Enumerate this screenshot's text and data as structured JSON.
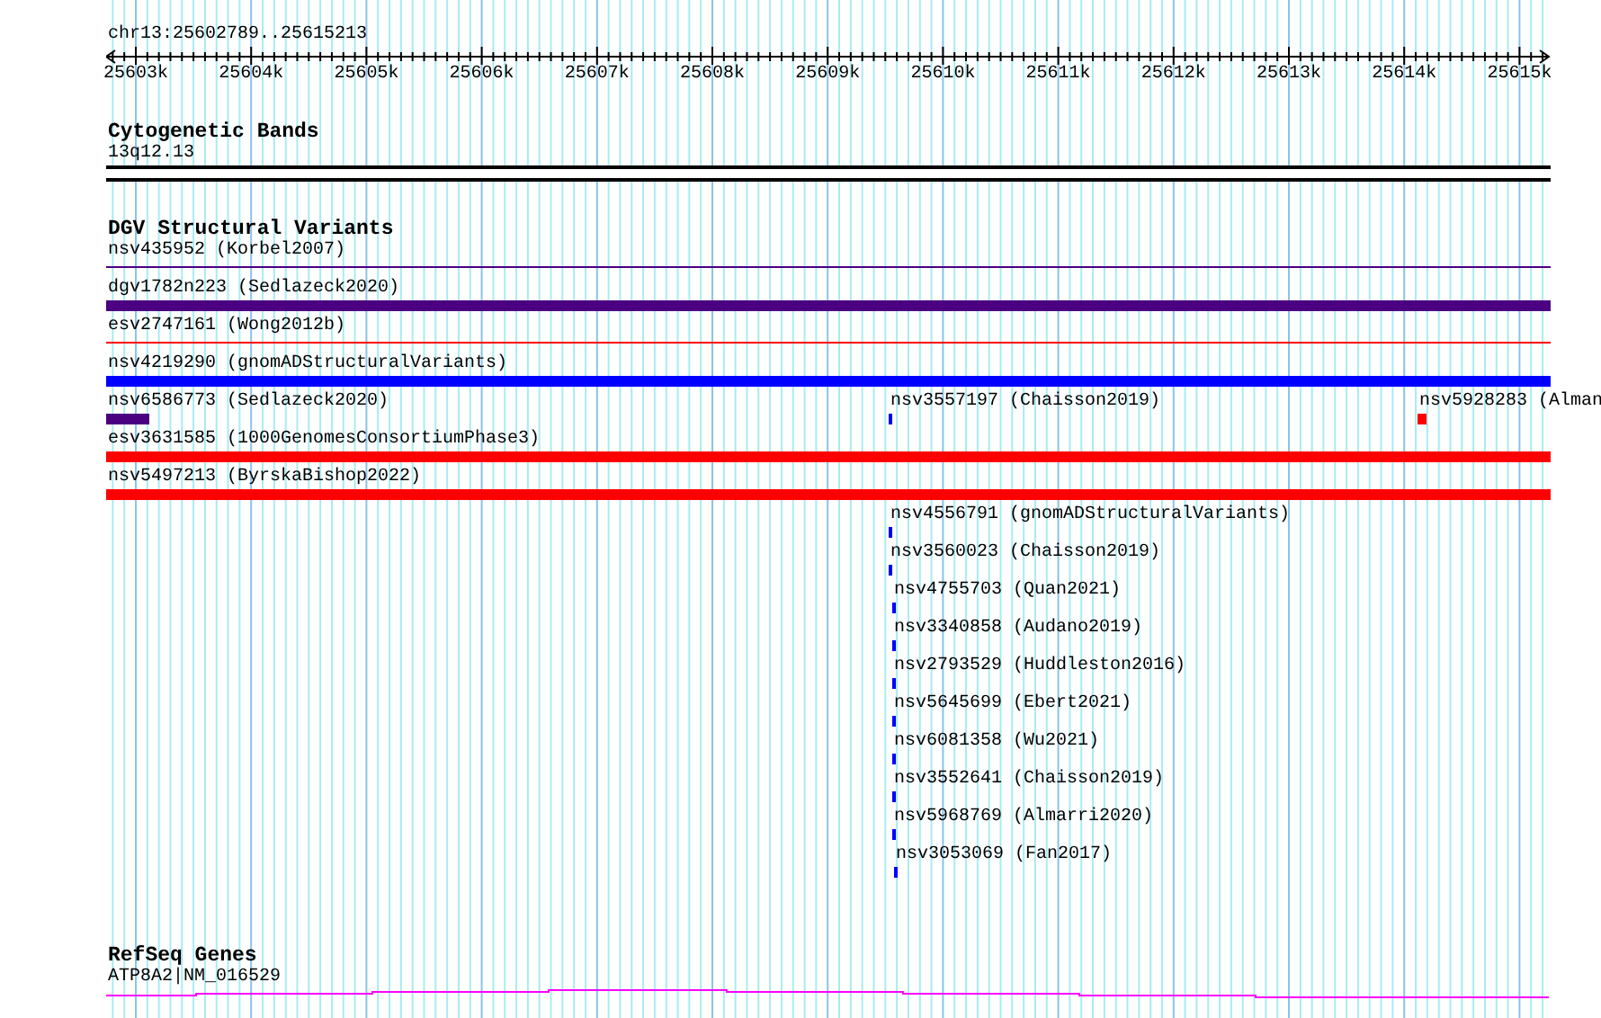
{
  "ruler": {
    "location": "chr13:25602789..25615213",
    "ticks": [
      "25603k",
      "25604k",
      "25605k",
      "25606k",
      "25607k",
      "25608k",
      "25609k",
      "25610k",
      "25611k",
      "25612k",
      "25613k",
      "25614k",
      "25615k"
    ]
  },
  "tracks": [
    {
      "title": "Cytogenetic Bands",
      "kind": "bands",
      "features": [
        {
          "label": "13q12.13"
        }
      ]
    },
    {
      "title": "DGV Structural Variants",
      "kind": "variants",
      "features": [
        {
          "label": "nsv435952 (Korbel2007)",
          "kind": "line",
          "color": "#4b0082"
        },
        {
          "label": "dgv1782n223 (Sedlazeck2020)",
          "kind": "bar",
          "color": "#4b0082"
        },
        {
          "label": "esv2747161 (Wong2012b)",
          "kind": "line",
          "color": "#ff0000"
        },
        {
          "label": "nsv4219290 (gnomADStructuralVariants)",
          "kind": "bar",
          "color": "#0000ff"
        },
        {
          "label": "nsv6586773 (Sedlazeck2020)",
          "kind": "bar",
          "color": "#4b0082"
        },
        {
          "label": "nsv3557197 (Chaisson2019)",
          "kind": "bar",
          "color": "#0000ff"
        },
        {
          "label": "nsv5928283 (Alman",
          "kind": "bar",
          "color": "#ff0000"
        },
        {
          "label": "esv3631585 (1000GenomesConsortiumPhase3)",
          "kind": "bar",
          "color": "#ff0000"
        },
        {
          "label": "nsv5497213 (ByrskaBishop2022)",
          "kind": "bar",
          "color": "#ff0000"
        },
        {
          "label": "nsv4556791 (gnomADStructuralVariants)",
          "kind": "bar",
          "color": "#0000ff"
        },
        {
          "label": "nsv3560023 (Chaisson2019)",
          "kind": "bar",
          "color": "#0000ff"
        },
        {
          "label": "nsv4755703 (Quan2021)",
          "kind": "bar",
          "color": "#0000ff"
        },
        {
          "label": "nsv3340858 (Audano2019)",
          "kind": "bar",
          "color": "#0000ff"
        },
        {
          "label": "nsv2793529 (Huddleston2016)",
          "kind": "bar",
          "color": "#0000ff"
        },
        {
          "label": "nsv5645699 (Ebert2021)",
          "kind": "bar",
          "color": "#0000ff"
        },
        {
          "label": "nsv6081358 (Wu2021)",
          "kind": "bar",
          "color": "#0000ff"
        },
        {
          "label": "nsv3552641 (Chaisson2019)",
          "kind": "bar",
          "color": "#0000ff"
        },
        {
          "label": "nsv5968769 (Almarri2020)",
          "kind": "bar",
          "color": "#0000ff"
        },
        {
          "label": "nsv3053069 (Fan2017)",
          "kind": "bar",
          "color": "#0000ff"
        }
      ]
    },
    {
      "title": "RefSeq Genes",
      "kind": "genes",
      "features": [
        {
          "label": "ATP8A2|NM_016529",
          "color": "#ff00ff"
        }
      ]
    }
  ]
}
